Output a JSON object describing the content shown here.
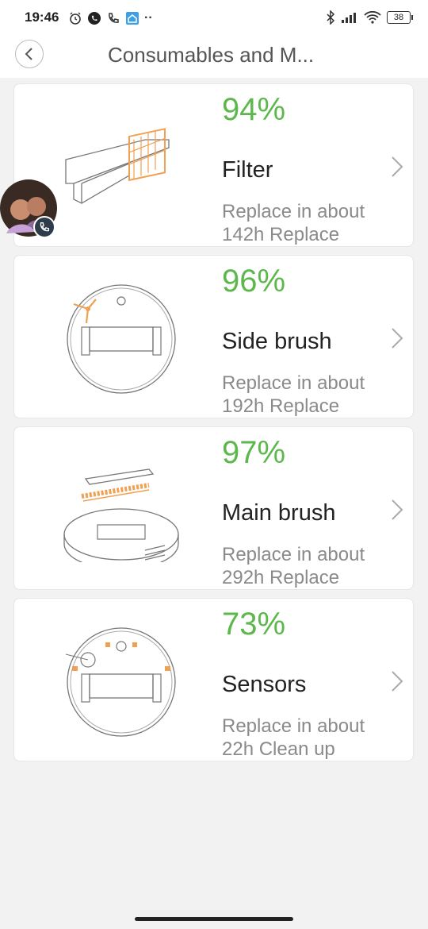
{
  "status": {
    "time": "19:46",
    "battery": "38"
  },
  "header": {
    "title": "Consumables and M..."
  },
  "items": [
    {
      "percent": "94%",
      "name": "Filter",
      "line1": "Replace in about",
      "line2": "142h Replace"
    },
    {
      "percent": "96%",
      "name": "Side brush",
      "line1": "Replace in about",
      "line2": "192h Replace"
    },
    {
      "percent": "97%",
      "name": "Main brush",
      "line1": "Replace in about",
      "line2": "292h Replace"
    },
    {
      "percent": "73%",
      "name": "Sensors",
      "line1": "Replace in about",
      "line2": "22h Clean up"
    }
  ],
  "colors": {
    "accent_green": "#5cb84c",
    "accent_orange": "#f0a050"
  }
}
